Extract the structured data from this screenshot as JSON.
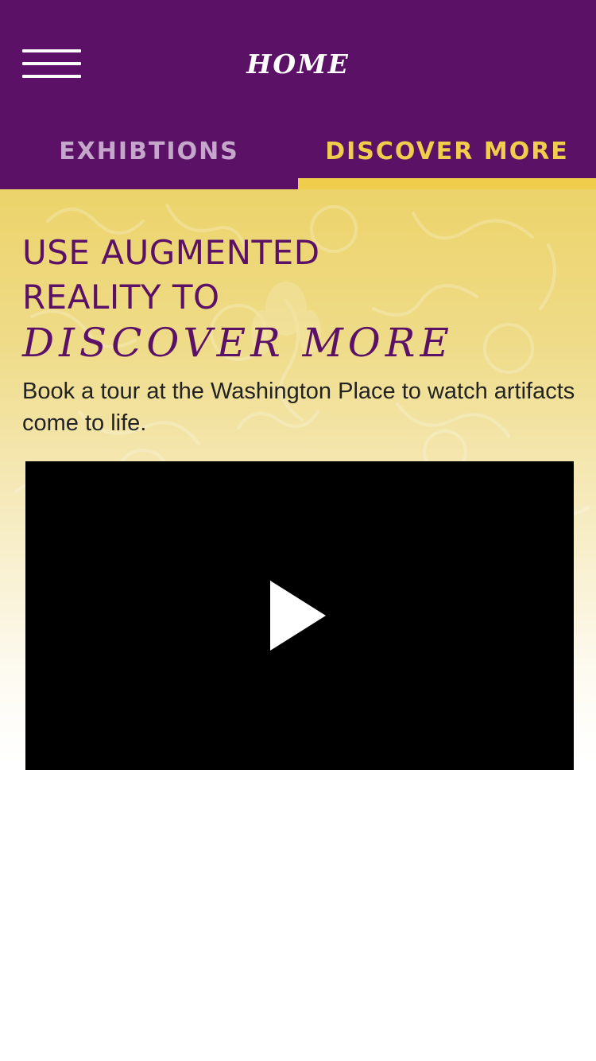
{
  "header": {
    "title": "HOME",
    "menu_icon": "hamburger-menu-icon"
  },
  "tabs": [
    {
      "label": "EXHIBTIONS",
      "active": false
    },
    {
      "label": "DISCOVER MORE",
      "active": true
    }
  ],
  "hero": {
    "headline_line1": "USE AUGMENTED",
    "headline_line2": "REALITY TO",
    "headline_line3": "DISCOVER MORE",
    "description": "Book a tour at the Washington Place to watch artifacts come to life."
  },
  "video": {
    "icon": "play-icon"
  },
  "colors": {
    "brand_purple": "#5b1166",
    "accent_gold": "#f1cd4c",
    "inactive_tab": "#c5a7cc"
  }
}
